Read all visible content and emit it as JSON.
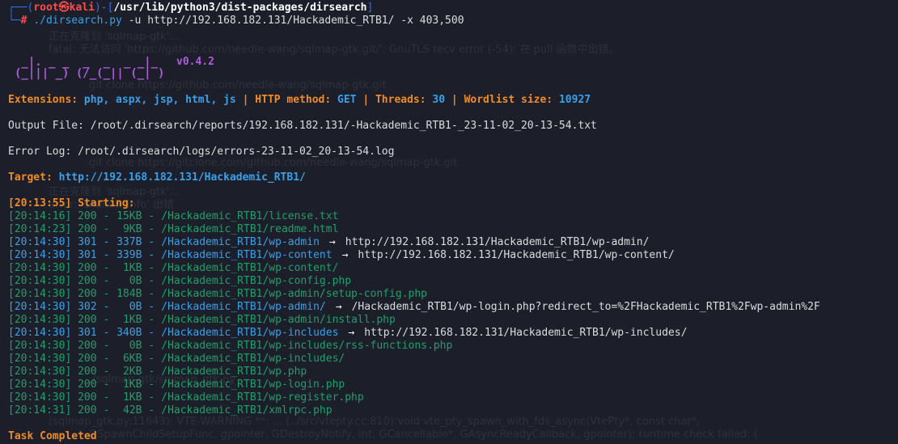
{
  "prompt": {
    "user": "root",
    "at": "㉿",
    "host": "kali",
    "cwd": "/usr/lib/python3/dist-packages/dirsearch",
    "hash": "#",
    "command": "./dirsearch.py",
    "args": "-u http://192.168.182.131/Hackademic_RTB1/ -x 403,500"
  },
  "logo": {
    "line1": " _|. _ _  _  _  _ _|_",
    "line2": "(_||| _) (/_(_|| (_| )",
    "version": "v0.4.2"
  },
  "config": {
    "extensions_label": "Extensions:",
    "extensions_value": "php, aspx, jsp, html, js",
    "sep": "|",
    "method_label": "HTTP method:",
    "method_value": "GET",
    "threads_label": "Threads:",
    "threads_value": "30",
    "wordlist_label": "Wordlist size:",
    "wordlist_value": "10927"
  },
  "output_file": "Output File: /root/.dirsearch/reports/192.168.182.131/-Hackademic_RTB1-_23-11-02_20-13-54.txt",
  "error_log": "Error Log: /root/.dirsearch/logs/errors-23-11-02_20-13-54.log",
  "target": {
    "label": "Target:",
    "url": "http://192.168.182.131/Hackademic_RTB1/"
  },
  "starting": "[20:13:55] Starting:",
  "results": [
    {
      "time": "[20:14:16]",
      "code": "200",
      "size": "15KB",
      "path": "/Hackademic_RTB1/license.txt",
      "redirect": ""
    },
    {
      "time": "[20:14:23]",
      "code": "200",
      "size": "9KB",
      "path": "/Hackademic_RTB1/readme.html",
      "redirect": ""
    },
    {
      "time": "[20:14:30]",
      "code": "301",
      "size": "337B",
      "path": "/Hackademic_RTB1/wp-admin",
      "redirect": "http://192.168.182.131/Hackademic_RTB1/wp-admin/"
    },
    {
      "time": "[20:14:30]",
      "code": "301",
      "size": "339B",
      "path": "/Hackademic_RTB1/wp-content",
      "redirect": "http://192.168.182.131/Hackademic_RTB1/wp-content/"
    },
    {
      "time": "[20:14:30]",
      "code": "200",
      "size": "1KB",
      "path": "/Hackademic_RTB1/wp-content/",
      "redirect": ""
    },
    {
      "time": "[20:14:30]",
      "code": "200",
      "size": "0B",
      "path": "/Hackademic_RTB1/wp-config.php",
      "redirect": ""
    },
    {
      "time": "[20:14:30]",
      "code": "200",
      "size": "184B",
      "path": "/Hackademic_RTB1/wp-admin/setup-config.php",
      "redirect": ""
    },
    {
      "time": "[20:14:30]",
      "code": "302",
      "size": "0B",
      "path": "/Hackademic_RTB1/wp-admin/",
      "redirect": "/Hackademic_RTB1/wp-login.php?redirect_to=%2FHackademic_RTB1%2Fwp-admin%2F"
    },
    {
      "time": "[20:14:30]",
      "code": "200",
      "size": "1KB",
      "path": "/Hackademic_RTB1/wp-admin/install.php",
      "redirect": ""
    },
    {
      "time": "[20:14:30]",
      "code": "301",
      "size": "340B",
      "path": "/Hackademic_RTB1/wp-includes",
      "redirect": "http://192.168.182.131/Hackademic_RTB1/wp-includes/"
    },
    {
      "time": "[20:14:30]",
      "code": "200",
      "size": "0B",
      "path": "/Hackademic_RTB1/wp-includes/rss-functions.php",
      "redirect": ""
    },
    {
      "time": "[20:14:30]",
      "code": "200",
      "size": "6KB",
      "path": "/Hackademic_RTB1/wp-includes/",
      "redirect": ""
    },
    {
      "time": "[20:14:30]",
      "code": "200",
      "size": "2KB",
      "path": "/Hackademic_RTB1/wp.php",
      "redirect": ""
    },
    {
      "time": "[20:14:30]",
      "code": "200",
      "size": "1KB",
      "path": "/Hackademic_RTB1/wp-login.php",
      "redirect": ""
    },
    {
      "time": "[20:14:30]",
      "code": "200",
      "size": "1KB",
      "path": "/Hackademic_RTB1/wp-register.php",
      "redirect": ""
    },
    {
      "time": "[20:14:31]",
      "code": "200",
      "size": "42B",
      "path": "/Hackademic_RTB1/xmlrpc.php",
      "redirect": ""
    }
  ],
  "arrow_glyph": "→",
  "dash": "-",
  "task_completed": "Task Completed",
  "ghost_lines": [
    "正在克隆到 'sqlmap-gtk'...",
    "fatal: 无法访问 'https://github.com/needle-wang/sqlmap-gtk.git/': GnuTLS recv error (-54): 在 pull 函数中出错。",
    "git clone https://github.com/needle-wang/sqlmap-gtk.git",
    "git clone https://gitclone.com/github.com/needle-wang/sqlmap-gtk.git",
    "正在克隆到 'sqlmap-gtk'...",
    "error: 'shallow-info' 出错",
    "./sqlmap-gtk/sqlmap_gtk.py",
    "(sqlmap_gtk.py:11643): VTE-WARNING **: ... (../src/vtepty.cc:810):void vte_pty_spawn_with_fds_async(VtePty*, const char*,",
    "GSpawnChildSetupFunc, gpointer, GDestroyNotify, int, GCancellable*, GAsyncReadyCallback, gpointer): runtime check failed: ("
  ],
  "colors": {
    "background": "#1c1f2a",
    "prompt_blue": "#2f6ee4",
    "prompt_red": "#ff4b4b",
    "label_orange": "#f08c25",
    "value_cyan": "#3aa0e8",
    "result_green": "#1f9f6a",
    "logo_purple": "#b05cdd"
  }
}
